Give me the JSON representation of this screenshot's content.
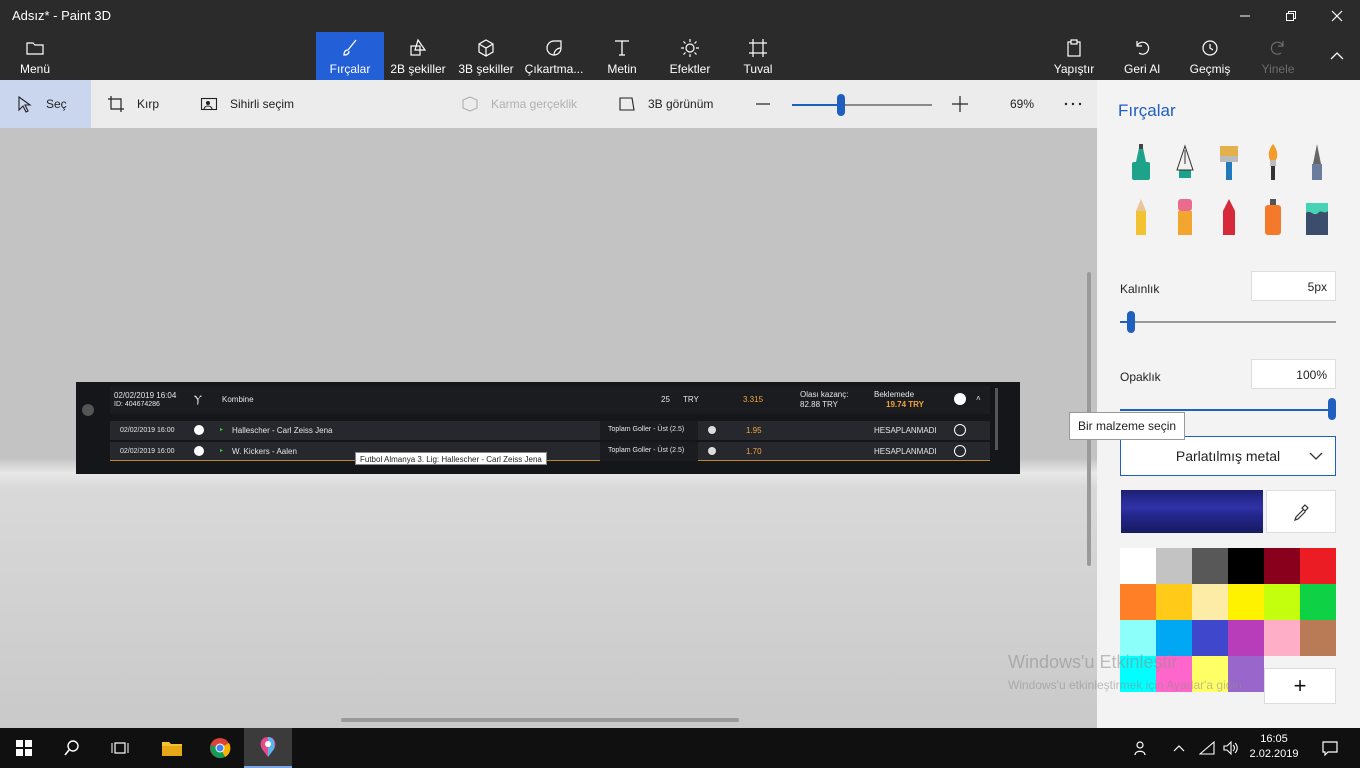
{
  "window": {
    "title": "Adsız* - Paint 3D",
    "controls": [
      "minimize-icon",
      "maximize-icon",
      "close-icon"
    ]
  },
  "ribbon": {
    "menu_label": "Menü",
    "tabs": [
      {
        "label": "Fırçalar",
        "icon": "brush-icon",
        "active": true
      },
      {
        "label": "2B şekiller",
        "icon": "2d-shapes-icon"
      },
      {
        "label": "3B şekiller",
        "icon": "3d-shapes-icon"
      },
      {
        "label": "Çıkartma...",
        "icon": "sticker-icon"
      },
      {
        "label": "Metin",
        "icon": "text-icon"
      },
      {
        "label": "Efektler",
        "icon": "effects-icon"
      },
      {
        "label": "Tuval",
        "icon": "canvas-icon"
      }
    ],
    "right": [
      {
        "label": "Yapıştır",
        "icon": "paste-icon"
      },
      {
        "label": "Geri Al",
        "icon": "undo-icon"
      },
      {
        "label": "Geçmiş",
        "icon": "history-icon"
      },
      {
        "label": "Yinele",
        "icon": "redo-icon",
        "disabled": true
      }
    ]
  },
  "toolbar": {
    "select": "Seç",
    "crop": "Kırp",
    "magic_select": "Sihirli seçim",
    "mixed_reality": "Karma gerçeklik",
    "view_3d": "3B görünüm",
    "zoom": "69%",
    "zoom_level": 0.35
  },
  "embedded_screenshot": {
    "header": {
      "date": "02/02/2019 16:04",
      "id": "ID: 404674286",
      "type": "Kombine",
      "stake": "25",
      "currency": "TRY",
      "odds": "3.315",
      "win_label": "Olası kazanç:",
      "win_value": "82.88 TRY",
      "status": "Beklemede",
      "status_value": "19.74 TRY"
    },
    "rows": [
      {
        "date": "02/02/2019 16:00",
        "match": "Hallescher - Carl Zeiss Jena",
        "market": "Toplam Goller - Üst (2.5)",
        "odds": "1.95",
        "status": "HESAPLANMADI"
      },
      {
        "date": "02/02/2019 16:00",
        "match": "W. Kickers - Aalen",
        "market": "Toplam Goller - Üst (2.5)",
        "odds": "1.70",
        "status": "HESAPLANMADI"
      }
    ],
    "tooltip": "Futbol  Almanya 3. Lig: Hallescher  - Carl Zeiss Jena"
  },
  "panel": {
    "title": "Fırçalar",
    "brushes": [
      "marker-icon",
      "calligraphy-pen-icon",
      "oil-brush-icon",
      "watercolor-icon",
      "pixel-pen-icon",
      "pencil-icon",
      "eraser-icon",
      "crayon-icon",
      "spray-can-icon",
      "fill-icon"
    ],
    "thickness_label": "Kalınlık",
    "thickness_value": "5px",
    "thickness_level": 0.05,
    "opacity_label": "Opaklık",
    "opacity_value": "100%",
    "opacity_level": 1.0,
    "tooltip": "Bir malzeme seçin",
    "material": "Parlatılmış metal",
    "palette": [
      "#ffffff",
      "#c3c3c3",
      "#585858",
      "#000000",
      "#88001b",
      "#ec1c24",
      "#ff7f27",
      "#ffca18",
      "#fdeca6",
      "#fff200",
      "#c4ff0e",
      "#0ed145",
      "#8cfffb",
      "#00a8f3",
      "#3f48cc",
      "#b83dba",
      "#ffaec8",
      "#b97a56",
      "#00ffff",
      "#ff66cc",
      "#ffff66",
      "#9966cc"
    ],
    "add_color": "+"
  },
  "watermark": {
    "line1": "Windows'u Etkinleştir",
    "line2": "Windows'u etkinleştirmek için Ayarlar'a gidin."
  },
  "taskbar": {
    "time": "16:05",
    "date": "2.02.2019"
  }
}
